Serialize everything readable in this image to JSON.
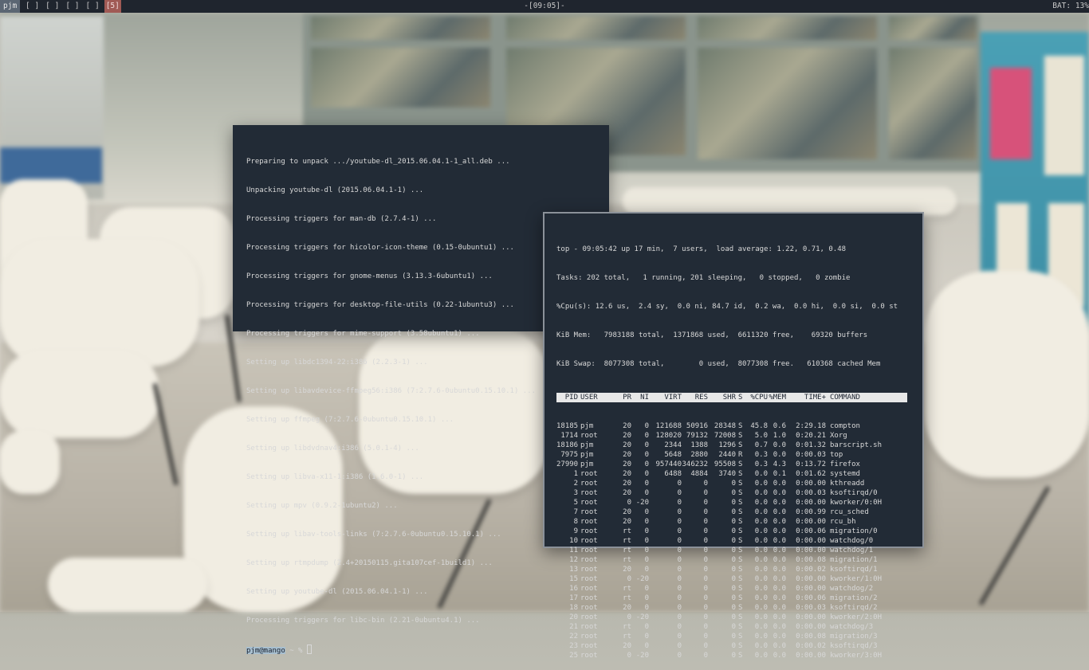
{
  "topbar": {
    "user": "pjm",
    "workspaces": [
      "[ ]",
      "[ ]",
      "[ ]",
      "[ ]",
      "[5]"
    ],
    "clock": "-[09:05]-",
    "battery": "BAT: 13%"
  },
  "colors": {
    "bar_bg": "#1f252e",
    "terminal_bg": "#222b36",
    "active_workspace": "#a05a55",
    "prompt_highlight": "#a8bfcf"
  },
  "terminal1": {
    "lines": [
      "Preparing to unpack .../youtube-dl_2015.06.04.1-1_all.deb ...",
      "Unpacking youtube-dl (2015.06.04.1-1) ...",
      "Processing triggers for man-db (2.7.4-1) ...",
      "Processing triggers for hicolor-icon-theme (0.15-0ubuntu1) ...",
      "Processing triggers for gnome-menus (3.13.3-6ubuntu1) ...",
      "Processing triggers for desktop-file-utils (0.22-1ubuntu3) ...",
      "Processing triggers for mime-support (3.58ubuntu1) ...",
      "Setting up libdc1394-22:i386 (2.2.3-1) ...",
      "Setting up libavdevice-ffmpeg56:i386 (7:2.7.6-0ubuntu0.15.10.1) ...",
      "Setting up ffmpeg (7:2.7.6-0ubuntu0.15.10.1) ...",
      "Setting up libdvdnav4:i386 (5.0.1-4) ...",
      "Setting up libva-x11-1:i386 (1.6.0-1) ...",
      "Setting up mpv (0.9.2-1ubuntu2) ...",
      "Setting up libav-tools-links (7:2.7.6-0ubuntu0.15.10.1) ...",
      "Setting up rtmpdump (2.4+20150115.gita107cef-1build1) ...",
      "Setting up youtube-dl (2015.06.04.1-1) ...",
      "Processing triggers for libc-bin (2.21-0ubuntu4.1) ..."
    ],
    "prompt_user": "pjm@mango",
    "prompt_rest": " ~ % "
  },
  "terminal2": {
    "summary": [
      "top - 09:05:42 up 17 min,  7 users,  load average: 1.22, 0.71, 0.48",
      "Tasks: 202 total,   1 running, 201 sleeping,   0 stopped,   0 zombie",
      "%Cpu(s): 12.6 us,  2.4 sy,  0.0 ni, 84.7 id,  0.2 wa,  0.0 hi,  0.0 si,  0.0 st",
      "KiB Mem:   7983188 total,  1371868 used,  6611320 free,    69320 buffers",
      "KiB Swap:  8077308 total,        0 used,  8077308 free.   610368 cached Mem"
    ],
    "header": [
      "PID",
      "USER",
      "PR",
      "NI",
      "VIRT",
      "RES",
      "SHR",
      "S",
      "%CPU",
      "%MEM",
      "TIME+",
      "COMMAND"
    ],
    "processes": [
      [
        "18185",
        "pjm",
        "20",
        "0",
        "121688",
        "50916",
        "28348",
        "S",
        "45.8",
        "0.6",
        "2:29.18",
        "compton"
      ],
      [
        "1714",
        "root",
        "20",
        "0",
        "128020",
        "79132",
        "72008",
        "S",
        "5.0",
        "1.0",
        "0:20.21",
        "Xorg"
      ],
      [
        "18186",
        "pjm",
        "20",
        "0",
        "2344",
        "1388",
        "1296",
        "S",
        "0.7",
        "0.0",
        "0:01.32",
        "barscript.sh"
      ],
      [
        "7975",
        "pjm",
        "20",
        "0",
        "5648",
        "2880",
        "2440",
        "R",
        "0.3",
        "0.0",
        "0:00.03",
        "top"
      ],
      [
        "27990",
        "pjm",
        "20",
        "0",
        "957440",
        "346232",
        "95508",
        "S",
        "0.3",
        "4.3",
        "0:13.72",
        "firefox"
      ],
      [
        "1",
        "root",
        "20",
        "0",
        "6488",
        "4884",
        "3740",
        "S",
        "0.0",
        "0.1",
        "0:01.62",
        "systemd"
      ],
      [
        "2",
        "root",
        "20",
        "0",
        "0",
        "0",
        "0",
        "S",
        "0.0",
        "0.0",
        "0:00.00",
        "kthreadd"
      ],
      [
        "3",
        "root",
        "20",
        "0",
        "0",
        "0",
        "0",
        "S",
        "0.0",
        "0.0",
        "0:00.03",
        "ksoftirqd/0"
      ],
      [
        "5",
        "root",
        "0",
        "-20",
        "0",
        "0",
        "0",
        "S",
        "0.0",
        "0.0",
        "0:00.00",
        "kworker/0:0H"
      ],
      [
        "7",
        "root",
        "20",
        "0",
        "0",
        "0",
        "0",
        "S",
        "0.0",
        "0.0",
        "0:00.99",
        "rcu_sched"
      ],
      [
        "8",
        "root",
        "20",
        "0",
        "0",
        "0",
        "0",
        "S",
        "0.0",
        "0.0",
        "0:00.00",
        "rcu_bh"
      ],
      [
        "9",
        "root",
        "rt",
        "0",
        "0",
        "0",
        "0",
        "S",
        "0.0",
        "0.0",
        "0:00.06",
        "migration/0"
      ],
      [
        "10",
        "root",
        "rt",
        "0",
        "0",
        "0",
        "0",
        "S",
        "0.0",
        "0.0",
        "0:00.00",
        "watchdog/0"
      ],
      [
        "11",
        "root",
        "rt",
        "0",
        "0",
        "0",
        "0",
        "S",
        "0.0",
        "0.0",
        "0:00.00",
        "watchdog/1"
      ],
      [
        "12",
        "root",
        "rt",
        "0",
        "0",
        "0",
        "0",
        "S",
        "0.0",
        "0.0",
        "0:00.08",
        "migration/1"
      ],
      [
        "13",
        "root",
        "20",
        "0",
        "0",
        "0",
        "0",
        "S",
        "0.0",
        "0.0",
        "0:00.02",
        "ksoftirqd/1"
      ],
      [
        "15",
        "root",
        "0",
        "-20",
        "0",
        "0",
        "0",
        "S",
        "0.0",
        "0.0",
        "0:00.00",
        "kworker/1:0H"
      ],
      [
        "16",
        "root",
        "rt",
        "0",
        "0",
        "0",
        "0",
        "S",
        "0.0",
        "0.0",
        "0:00.00",
        "watchdog/2"
      ],
      [
        "17",
        "root",
        "rt",
        "0",
        "0",
        "0",
        "0",
        "S",
        "0.0",
        "0.0",
        "0:00.06",
        "migration/2"
      ],
      [
        "18",
        "root",
        "20",
        "0",
        "0",
        "0",
        "0",
        "S",
        "0.0",
        "0.0",
        "0:00.03",
        "ksoftirqd/2"
      ],
      [
        "20",
        "root",
        "0",
        "-20",
        "0",
        "0",
        "0",
        "S",
        "0.0",
        "0.0",
        "0:00.00",
        "kworker/2:0H"
      ],
      [
        "21",
        "root",
        "rt",
        "0",
        "0",
        "0",
        "0",
        "S",
        "0.0",
        "0.0",
        "0:00.00",
        "watchdog/3"
      ],
      [
        "22",
        "root",
        "rt",
        "0",
        "0",
        "0",
        "0",
        "S",
        "0.0",
        "0.0",
        "0:00.08",
        "migration/3"
      ],
      [
        "23",
        "root",
        "20",
        "0",
        "0",
        "0",
        "0",
        "S",
        "0.0",
        "0.0",
        "0:00.02",
        "ksoftirqd/3"
      ],
      [
        "25",
        "root",
        "0",
        "-20",
        "0",
        "0",
        "0",
        "S",
        "0.0",
        "0.0",
        "0:00.00",
        "kworker/3:0H"
      ]
    ]
  }
}
